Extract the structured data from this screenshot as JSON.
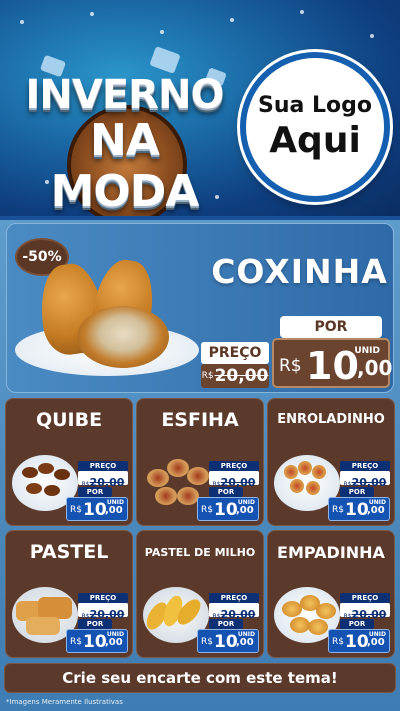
{
  "header": {
    "title_line1": "INVERNO",
    "title_line2": "NA MODA",
    "logo_line1": "Sua Logo",
    "logo_line2": "Aqui"
  },
  "featured": {
    "discount": "-50%",
    "name": "COXINHA",
    "preco_label": "PREÇO",
    "old_currency": "R$",
    "old_price": "20,00",
    "por_label": "POR",
    "unit": "UNID",
    "new_currency": "R$",
    "new_price_int": "10",
    "new_price_dec": ",00"
  },
  "price_labels": {
    "preco": "PREÇO",
    "por": "POR",
    "unit": "UNID",
    "currency": "R$",
    "old_value": "20,00",
    "new_int": "10",
    "new_dec": ",00"
  },
  "products": [
    {
      "name": "QUIBE"
    },
    {
      "name": "ESFIHA"
    },
    {
      "name": "ENROLADINHO"
    },
    {
      "name": "PASTEL"
    },
    {
      "name": "PASTEL DE MILHO"
    },
    {
      "name": "EMPADINHA"
    }
  ],
  "footer": {
    "cta": "Crie seu encarte com este tema!",
    "disclaimer": "*Imagens Meramente Ilustrativas"
  },
  "colors": {
    "brown": "#5b3a2c",
    "blue_dark": "#0d2f74",
    "blue_price": "#1553b3"
  }
}
